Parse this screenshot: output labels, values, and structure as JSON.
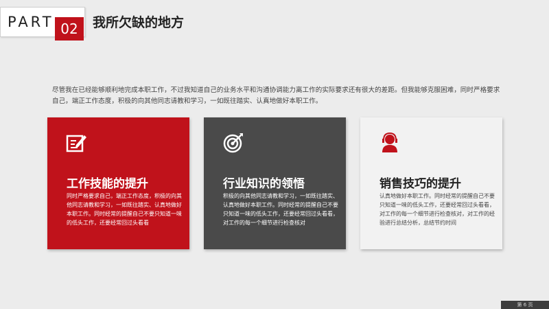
{
  "header": {
    "part_label": "PART",
    "part_number": "02",
    "title": "我所欠缺的地方"
  },
  "intro": "尽管我在已经能够顺利地完成本职工作，不过我知道自己的业务水平和沟通协调能力离工作的实际要求还有很大的差距。但我能够克服困难，同时严格要求自己，端正工作态度，积极的向其他同志请教和学习，一如既往踏实、认真地做好本职工作。",
  "cards": [
    {
      "icon": "edit-note-icon",
      "title": "工作技能的提升",
      "text": "同时严格要求自己，端正工作态度，积极的向其他同志请教和学习，一如既往踏实、认真地做好本职工作。同时经常的提醒自己不要只知道一味的低头工作，还要经常回过头看看"
    },
    {
      "icon": "target-icon",
      "title": "行业知识的领悟",
      "text": "积极的向其他同志请教和学习，一如既往踏实、认真地做好本职工作。同时经常的提醒自己不要只知道一味的低头工作，还要经常回过头看看，对工作的每一个细节进行检查核对"
    },
    {
      "icon": "user-headset-icon",
      "title": "销售技巧的提升",
      "text": "认真地做好本职工作。同时经常的提醒自己不要只知道一味的低头工作，还要经常回过头看看，对工作的每一个细节进行检查核对，对工作的经验进行总结分析，总结节约时间"
    }
  ],
  "footer": {
    "page_label": "第 6 页"
  },
  "colors": {
    "accent": "#c0121b",
    "dark": "#4a4a4a",
    "light": "#f2f2f2",
    "background": "#ececec"
  }
}
